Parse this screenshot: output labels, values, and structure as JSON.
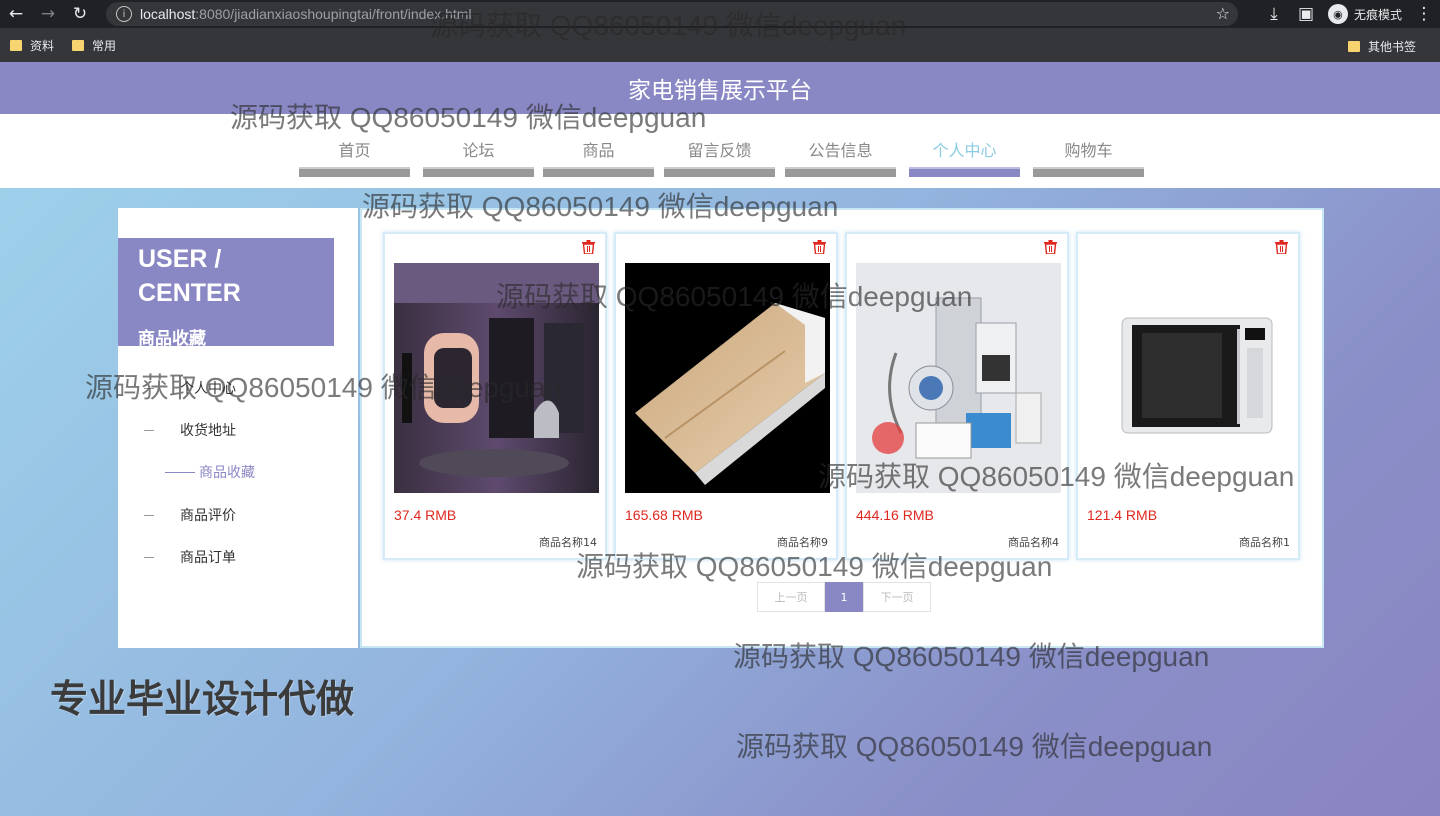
{
  "browser": {
    "url_host": "localhost",
    "url_path": ":8080/jiadianxiaoshoupingtai/front/index.html",
    "incognito_label": "无痕模式",
    "bookmarks": [
      "资料",
      "常用"
    ],
    "other_bookmarks": "其他书签"
  },
  "site": {
    "title": "家电销售展示平台",
    "nav": [
      "首页",
      "论坛",
      "商品",
      "留言反馈",
      "公告信息",
      "个人中心",
      "购物车"
    ],
    "active_nav": "个人中心"
  },
  "sidebar": {
    "title": "USER / CENTER",
    "subtitle": "商品收藏",
    "items": [
      "个人中心",
      "收货地址",
      "商品收藏",
      "商品评价",
      "商品订单"
    ],
    "active_item": "商品收藏"
  },
  "products": [
    {
      "price": "37.4 RMB",
      "name": "商品名称14"
    },
    {
      "price": "165.68 RMB",
      "name": "商品名称9"
    },
    {
      "price": "444.16 RMB",
      "name": "商品名称4"
    },
    {
      "price": "121.4 RMB",
      "name": "商品名称1"
    }
  ],
  "pagination": {
    "prev": "上一页",
    "current": "1",
    "next": "下一页"
  },
  "promo": "专业毕业设计代做",
  "watermark": "源码获取 QQ86050149 微信deepguan",
  "colors": {
    "accent": "#8a88c4",
    "price": "#e0281f",
    "chrome": "#202124"
  }
}
